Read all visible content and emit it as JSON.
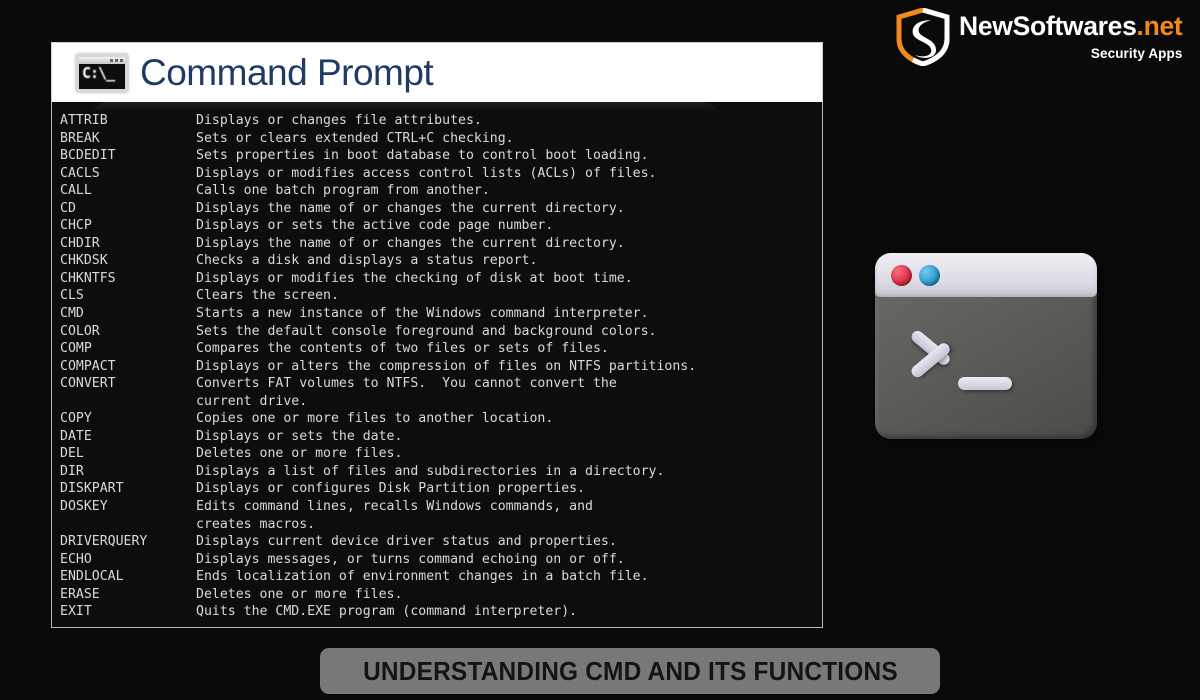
{
  "background_color": "#0a0a0a",
  "brand": {
    "name_primary": "NewSoftwares",
    "name_suffix": ".net",
    "tagline": "Security Apps",
    "mark_icon": "shield-logo-icon",
    "colors": {
      "white": "#ffffff",
      "orange": "#f08a1c"
    }
  },
  "cmd_window": {
    "app_icon": "cmd-window-icon",
    "app_icon_text": "C:\\_",
    "title": "Command Prompt",
    "title_color": "#1f3a66",
    "titlebar_bg": "#ffffff",
    "console_bg": "#0d0d0d",
    "console_text_color": "#d9d9d9",
    "lines": [
      {
        "command": "ATTRIB",
        "description": "Displays or changes file attributes."
      },
      {
        "command": "BREAK",
        "description": "Sets or clears extended CTRL+C checking."
      },
      {
        "command": "BCDEDIT",
        "description": "Sets properties in boot database to control boot loading."
      },
      {
        "command": "CACLS",
        "description": "Displays or modifies access control lists (ACLs) of files."
      },
      {
        "command": "CALL",
        "description": "Calls one batch program from another."
      },
      {
        "command": "CD",
        "description": "Displays the name of or changes the current directory."
      },
      {
        "command": "CHCP",
        "description": "Displays or sets the active code page number."
      },
      {
        "command": "CHDIR",
        "description": "Displays the name of or changes the current directory."
      },
      {
        "command": "CHKDSK",
        "description": "Checks a disk and displays a status report."
      },
      {
        "command": "CHKNTFS",
        "description": "Displays or modifies the checking of disk at boot time."
      },
      {
        "command": "CLS",
        "description": "Clears the screen."
      },
      {
        "command": "CMD",
        "description": "Starts a new instance of the Windows command interpreter."
      },
      {
        "command": "COLOR",
        "description": "Sets the default console foreground and background colors."
      },
      {
        "command": "COMP",
        "description": "Compares the contents of two files or sets of files."
      },
      {
        "command": "COMPACT",
        "description": "Displays or alters the compression of files on NTFS partitions."
      },
      {
        "command": "CONVERT",
        "description": "Converts FAT volumes to NTFS.  You cannot convert the"
      },
      {
        "command": "",
        "description": "current drive."
      },
      {
        "command": "COPY",
        "description": "Copies one or more files to another location."
      },
      {
        "command": "DATE",
        "description": "Displays or sets the date."
      },
      {
        "command": "DEL",
        "description": "Deletes one or more files."
      },
      {
        "command": "DIR",
        "description": "Displays a list of files and subdirectories in a directory."
      },
      {
        "command": "DISKPART",
        "description": "Displays or configures Disk Partition properties."
      },
      {
        "command": "DOSKEY",
        "description": "Edits command lines, recalls Windows commands, and"
      },
      {
        "command": "",
        "description": "creates macros."
      },
      {
        "command": "DRIVERQUERY",
        "description": "Displays current device driver status and properties."
      },
      {
        "command": "ECHO",
        "description": "Displays messages, or turns command echoing on or off."
      },
      {
        "command": "ENDLOCAL",
        "description": "Ends localization of environment changes in a batch file."
      },
      {
        "command": "ERASE",
        "description": "Deletes one or more files."
      },
      {
        "command": "EXIT",
        "description": "Quits the CMD.EXE program (command interpreter)."
      }
    ]
  },
  "terminal_illustration": {
    "icon": "terminal-3d-icon",
    "prompt_glyph": ">_",
    "dot_red": "#e0314b",
    "dot_blue": "#2f9fd4",
    "body_color": "#5f5d59",
    "titlebar_color": "#dedce4"
  },
  "caption": {
    "text": "UNDERSTANDING CMD AND ITS FUNCTIONS",
    "background": "#787878",
    "text_color": "#141414"
  }
}
